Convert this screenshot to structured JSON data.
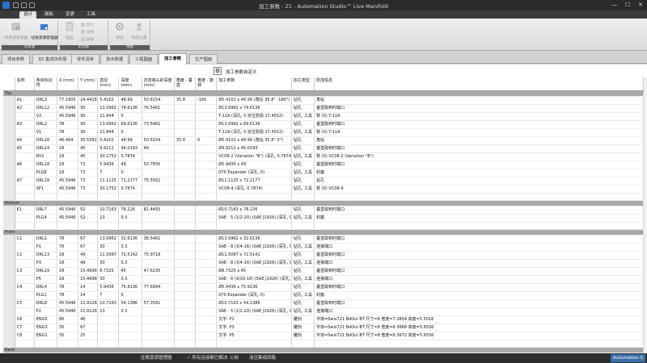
{
  "window": {
    "title": "加工参数 - Z1 - Automation Studio™ Live Manifold",
    "minimize": "—",
    "maximize": "☐",
    "close": "✕"
  },
  "ribbon": {
    "tabs": [
      "设计",
      "面板",
      "变更",
      "工具"
    ],
    "active_tab": "设计",
    "groups": [
      {
        "label": "项目源",
        "buttons": [
          {
            "label": "库源源管理器",
            "icon": "project-explorer-icon",
            "enabled": false
          },
          {
            "label": "往歌源源管理器",
            "icon": "library-explorer-icon",
            "enabled": true
          }
        ]
      },
      {
        "label": "剪切板",
        "buttons": [
          {
            "label": "粘贴",
            "icon": "paste-icon",
            "enabled": false
          }
        ],
        "small": [
          "剪切",
          "复制",
          "删除"
        ]
      },
      {
        "label": "视图",
        "buttons": [
          {
            "label": "属性",
            "icon": "properties-icon",
            "enabled": false
          },
          {
            "label": "到底位置",
            "icon": "position-icon",
            "enabled": false
          }
        ]
      }
    ]
  },
  "view_tabs": [
    "项目参数",
    "3D 集成块布局",
    "零件清单",
    "技术数据",
    "工程图面",
    "加工参数",
    "生产图面"
  ],
  "active_view_tab": "加工参数",
  "custom_button": {
    "label": "加工参数自定义",
    "icon": "gear-icon"
  },
  "columns": [
    "名称",
    "条目标识符",
    "X (mm)",
    "Y (mm)",
    "直径 (mm)",
    "深度 (mm)",
    "定容端头的深度 (mm)",
    "角度 - 垂直",
    "角度 - 旋转",
    "加工参数",
    "加工类型",
    "附加信息"
  ],
  "sections": [
    {
      "name": "Top",
      "rows": [
        [
          "A1",
          "DRL3",
          "77.1905",
          "24.4418",
          "5.4102",
          "48.99",
          "50.6154",
          "35.8",
          "-180",
          "Ø5.4102 x 48.99 (角钻 35.8° -180°)",
          "钻孔",
          "角钻"
        ],
        [
          "A2",
          "DRL12",
          "45.5946",
          "30",
          "13.0962",
          "74.6136",
          "76.5461",
          "",
          "",
          "Ø13.0962 x 74.6136",
          "钻孔",
          "垂直取到时端口"
        ],
        [
          "",
          "V2",
          "45.5946",
          "30",
          "21.844",
          "0",
          "",
          "",
          "",
          "T-11A (深孔, 0 定位防损 17.4552)",
          "钻孔, 工具",
          "数 (0) T-11A"
        ],
        [
          "A3",
          "DRL2",
          "78",
          "30",
          "13.0962",
          "69.6136",
          "73.5461",
          "",
          "",
          "Ø13.0962 x 69.6136",
          "钻孔",
          "垂直取到时端口"
        ],
        [
          "",
          "V1",
          "78",
          "30",
          "21.844",
          "0",
          "",
          "",
          "",
          "T-11A (深孔, 0 定位防损 17.4552)",
          "钻孔, 工具",
          "数 (0) T-11A"
        ],
        [
          "A4",
          "DRL16",
          "46.464",
          "35.5582",
          "5.4102",
          "48.99",
          "50.6154",
          "35.8",
          "0",
          "Ø5.4102 x 48.99 (角钻 35.8° 0°)",
          "钻孔",
          "角钻"
        ],
        [
          "A5",
          "DRL14",
          "18",
          "45",
          "9.9212",
          "46.0193",
          "49",
          "",
          "",
          "Ø9.9212 x 46.0193",
          "钻孔",
          "垂直取到时端口"
        ],
        [
          "",
          "RV1",
          "18",
          "45",
          "30.1752",
          "0.7874",
          "",
          "",
          "",
          "VC08-2 (Variation \"B\") (深孔, 0.7874)",
          "钻孔, 工具",
          "数 (0) VC08-2 (Variation \"B\")"
        ],
        [
          "A6",
          "DRL18",
          "18",
          "73",
          "5.9436",
          "49",
          "50.7856",
          "",
          "",
          "Ø5.9436 x 49",
          "钻孔",
          "垂直取到时端口"
        ],
        [
          "",
          "PLG8",
          "18",
          "73",
          "7",
          "0",
          "",
          "",
          "",
          "070 Expander (深孔, 0)",
          "钻孔, 工具",
          "封塞"
        ],
        [
          "A7",
          "DRL18",
          "45.5946",
          "73",
          "11.1125",
          "72.2177",
          "75.5562",
          "",
          "",
          "Ø11.1125 x 72.2177",
          "钻孔",
          "钻孔"
        ],
        [
          "",
          "SP1",
          "45.5946",
          "73",
          "30.1752",
          "0.7874",
          "",
          "",
          "",
          "VC08-4 (深孔, 0.7874)",
          "钻孔, 工具",
          "数 (0) VC08-4"
        ]
      ]
    },
    {
      "name": "Bottom",
      "rows": [
        [
          "E1",
          "DRL7",
          "45.5946",
          "52",
          "10.7163",
          "78.226",
          "81.4455",
          "",
          "",
          "Ø10.7163 x 78.226",
          "钻孔",
          "垂直取到时端口"
        ],
        [
          "",
          "PLG4",
          "45.5946",
          "52",
          "23",
          "0.3",
          "",
          "",
          "",
          "SAE - 5 (1/2-20) (SAE J1926) (深孔, 0.3)",
          "钻孔, 工具",
          "封塞"
        ]
      ]
    },
    {
      "name": "Front",
      "rows": [
        [
          "C1",
          "DRL1",
          "78",
          "67",
          "13.0962",
          "32.6136",
          "36.5461",
          "",
          "",
          "Ø13.0962 x 32.6136",
          "钻孔",
          "垂直取到时端口"
        ],
        [
          "",
          "P1",
          "78",
          "67",
          "30",
          "0.3",
          "",
          "",
          "",
          "SAE - 8 (3/4-16) (SAE J1926) (深孔, 0.3)",
          "钻孔, 工具",
          "连接端口"
        ],
        [
          "C2",
          "DRL13",
          "18",
          "49",
          "11.5087",
          "72.5142",
          "75.9718",
          "",
          "",
          "Ø11.5087 x 72.5142",
          "钻孔",
          "垂直取到时端口"
        ],
        [
          "",
          "P3",
          "18",
          "49",
          "30",
          "0.3",
          "",
          "",
          "",
          "SAE - 8 (3/4-16) (SAE J1926) (深孔, 0.3)",
          "钻孔, 工具",
          "连接端口"
        ],
        [
          "C3",
          "DRL19",
          "18",
          "15.4698",
          "8.7325",
          "45",
          "47.6235",
          "",
          "",
          "Ø8.7325 x 45",
          "钻孔",
          "垂直取到时端口"
        ],
        [
          "",
          "P5",
          "18",
          "15.4698",
          "30",
          "0.3",
          "",
          "",
          "",
          "SAE - 6 (9/16-18) (SAE J1926) (深孔, 0.3)",
          "钻孔, 工具",
          "连接端口"
        ],
        [
          "C4",
          "DRL4",
          "78",
          "14",
          "5.9436",
          "75.9136",
          "77.6994",
          "",
          "",
          "Ø5.9436 x 75.9136",
          "钻孔",
          "垂直取到时端口"
        ],
        [
          "",
          "PLG1",
          "78",
          "14",
          "7",
          "0",
          "",
          "",
          "",
          "070 Expander (深孔, 0)",
          "钻孔, 工具",
          "封塞"
        ],
        [
          "C5",
          "DRL8",
          "45.5946",
          "11.9126",
          "10.7163",
          "54.1386",
          "57.3581",
          "",
          "",
          "Ø10.7163 x 54.1386",
          "钻孔",
          "垂直取到时端口"
        ],
        [
          "",
          "P2",
          "45.5946",
          "11.9126",
          "23",
          "0.3",
          "",
          "",
          "",
          "SAE - 5 (1/2-20) (SAE J1926) (深孔, 0.3)",
          "钻孔, 工具",
          "连接端口"
        ],
        [
          "C6",
          "ENG5",
          "86",
          "46",
          "",
          "",
          "",
          "",
          "",
          "文字: P1",
          "雕刻",
          "字体=Swis721 BdOul BT 尺寸=8 宽度=7.2804 高度=5.5016"
        ],
        [
          "C7",
          "ENG3",
          "35",
          "67",
          "",
          "",
          "",
          "",
          "",
          "文字: P3",
          "雕刻",
          "字体=Swis721 BdOul BT 尺寸=8 宽度=6.3868 高度=5.6556"
        ],
        [
          "C8",
          "ENG1",
          "35",
          "25",
          "",
          "",
          "",
          "",
          "",
          "文字: P5",
          "雕刻",
          "字体=Swis721 BdOul BT 尺寸=8 宽度=6.3672 高度=5.6556"
        ]
      ]
    },
    {
      "name": "Back",
      "rows": []
    }
  ],
  "status_bar": {
    "items": [
      "往歌源源管理器",
      "所有连接都已解决",
      "公制",
      "液压集成回路"
    ],
    "check_icon": "✔",
    "right_label": "Automation S"
  },
  "colors": {
    "section_header": "#a9a9a9",
    "title_bar": "#2b2b2b",
    "status_ok": "#3fcf3f",
    "active_tab": "#ffffff"
  }
}
